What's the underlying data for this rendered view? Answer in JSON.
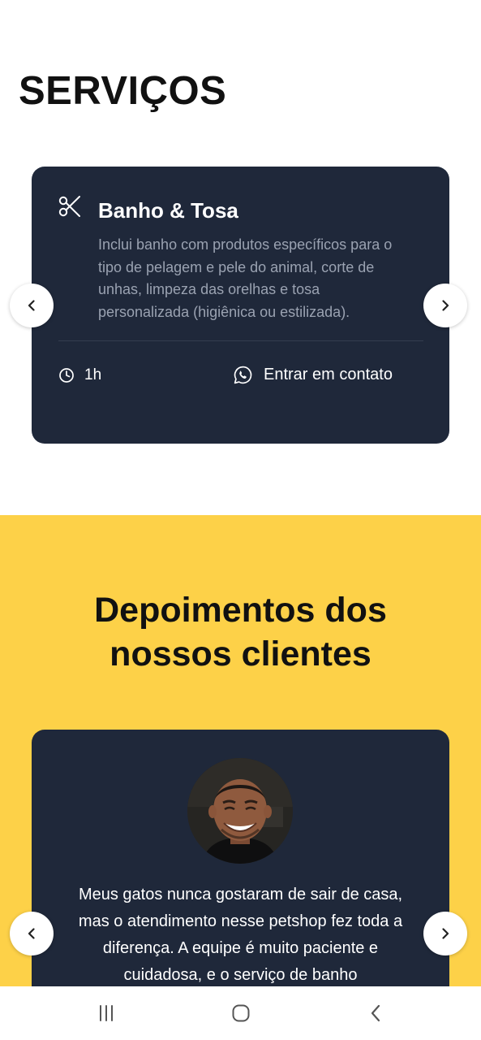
{
  "services": {
    "title": "SERVIÇOS",
    "card": {
      "icon": "scissors-icon",
      "name": "Banho & Tosa",
      "description_lines": [
        "Inclui banho com produtos específicos para o",
        "tipo de pelagem e pele do animal, corte de",
        "unhas, limpeza das orelhas e tosa",
        "personalizada (higiênica ou estilizada)."
      ],
      "duration": "1h",
      "contact_label": "Entrar em contato"
    }
  },
  "testimonials": {
    "title_line1": "Depoimentos dos",
    "title_line2": "nossos clientes",
    "quote_lines": [
      "Meus gatos nunca gostaram de sair de casa,",
      "mas o atendimento nesse petshop fez toda a",
      "diferença. A equipe é muito paciente e",
      "cuidadosa, e o serviço de banho"
    ]
  },
  "colors": {
    "card_bg": "#1f283a",
    "accent_yellow": "#fdd148",
    "muted_text": "#9aa2b1"
  }
}
